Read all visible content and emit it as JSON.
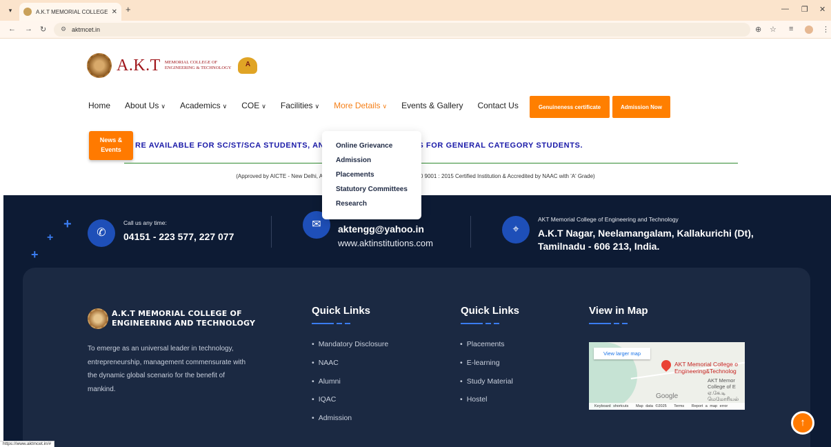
{
  "browser": {
    "tab_title": "A.K.T MEMORIAL COLLEGE OF",
    "new_tab": "+",
    "url": "aktmcet.in",
    "status_url": "https://www.aktmcet.in/#"
  },
  "header": {
    "logo_main": "A.K.T",
    "logo_sub_line1": "MEMORIAL COLLEGE OF",
    "logo_sub_line2": "ENGINEERING & TECHNOLOGY",
    "naac_badge": "A"
  },
  "nav": {
    "items": [
      {
        "label": "Home",
        "has_dropdown": false
      },
      {
        "label": "About Us",
        "has_dropdown": true
      },
      {
        "label": "Academics",
        "has_dropdown": true
      },
      {
        "label": "COE",
        "has_dropdown": true
      },
      {
        "label": "Facilities",
        "has_dropdown": true
      },
      {
        "label": "More Details",
        "has_dropdown": true,
        "active": true
      },
      {
        "label": "Events & Gallery",
        "has_dropdown": false
      },
      {
        "label": "Contact Us",
        "has_dropdown": false
      }
    ],
    "genuineness_btn": "Genuineness certificate",
    "admission_btn": "Admission Now",
    "chevron": "∨"
  },
  "news": {
    "button": "News & Events",
    "marquee": "RE AVAILABLE FOR SC/ST/SCA STUDENTS, AN                         ARSHIPS FOR GENERAL CATEGORY STUDENTS.",
    "approval": "(Approved by AICTE - New Delhi, Affili                                                           0 9001 : 2015 Certified Institution & Accredited by NAAC with 'A' Grade)"
  },
  "more_details_dropdown": {
    "items": [
      "Online Grievance",
      "Admission",
      "Placements",
      "Statutory Committees",
      "Research"
    ]
  },
  "contact": {
    "phone_label": "Call us any time:",
    "phone": "04151 - 223 577, 227 077",
    "email": "aktengg@yahoo.in",
    "website": "www.aktinstitutions.com",
    "address_label": "AKT Memorial College of Engineering and Technology",
    "address_line1": "A.K.T Nagar, Neelamangalam, Kallakurichi (Dt),",
    "address_line2": "Tamilnadu - 606 213, India."
  },
  "footer": {
    "logo_line1": "A.K.T MEMORIAL COLLEGE OF",
    "logo_line2": "ENGINEERING AND TECHNOLOGY",
    "about": "To emerge as an universal leader in technology, entrepreneurship, management commensurate with the dynamic global scenario for the benefit of mankind.",
    "quick_links_1": {
      "title": "Quick Links",
      "items": [
        "Mandatory Disclosure",
        "NAAC",
        "Alumni",
        "IQAC",
        "Admission"
      ]
    },
    "quick_links_2": {
      "title": "Quick Links",
      "items": [
        "Placements",
        "E-learning",
        "Study Material",
        "Hostel"
      ]
    },
    "map": {
      "title": "View in Map",
      "larger_map": "View larger map",
      "pin_label_line1": "AKT Memorial College o",
      "pin_label_line2": "Engineering&Technolog",
      "side_label_line1": "AKT Memor",
      "side_label_line2": "College of E",
      "side_label_line3": "ஏ.கே.டி",
      "side_label_line4": "மெமோரியல்",
      "google": "Google",
      "footer_text": "Keyboard shortcuts   Map data ©2025   Terms   Report a map error"
    },
    "scroll_top": "↑"
  },
  "colors": {
    "accent_orange": "#ff7f00",
    "footer_bg": "#0d1b34",
    "marquee_blue": "#1a1aa8",
    "logo_red": "#a0161b"
  }
}
